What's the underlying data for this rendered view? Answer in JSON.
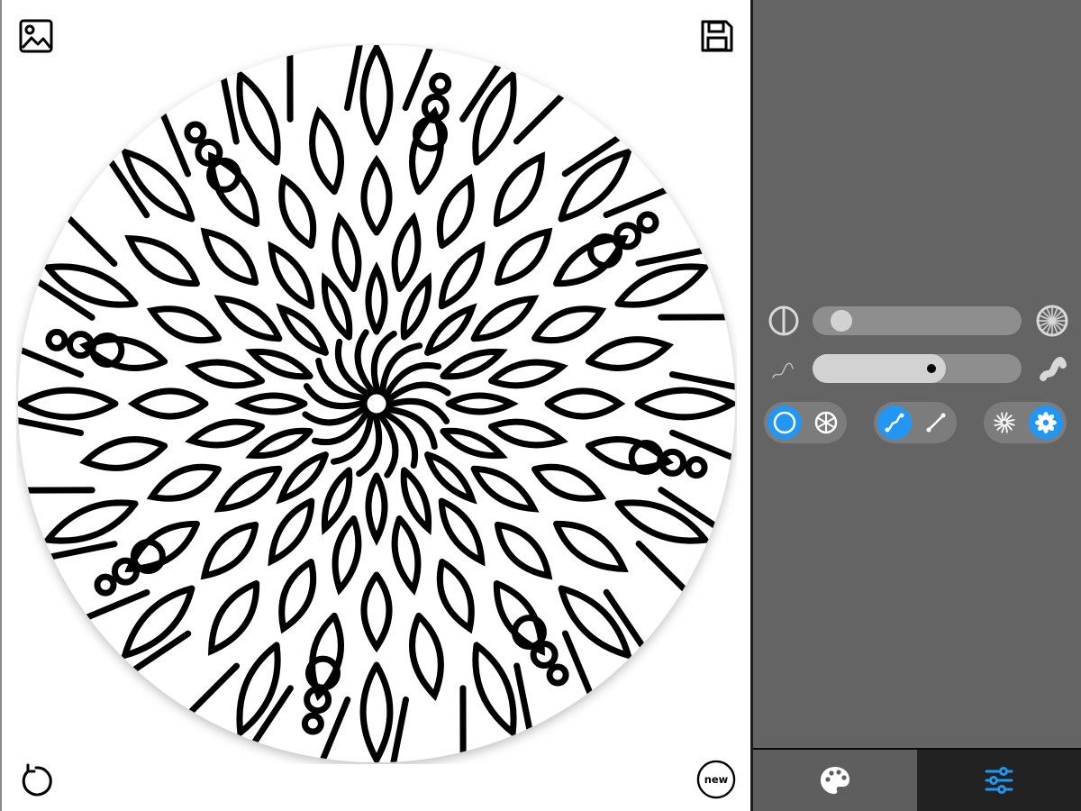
{
  "toolbar": {
    "open_image_icon": "image-icon",
    "save_icon": "floppy-disk-icon",
    "undo_icon": "undo-icon",
    "new_label": "new"
  },
  "settings": {
    "symmetry_slider": {
      "left_icon": "half-circle-icon",
      "right_icon": "radial-circle-icon",
      "value_fraction": 0.08
    },
    "brush_slider": {
      "left_icon": "thin-stroke-icon",
      "right_icon": "thick-stroke-icon",
      "value_fraction": 0.58
    },
    "toggles": [
      {
        "name": "shape",
        "options": [
          "circle-icon",
          "segmented-circle-icon"
        ],
        "selected": 0
      },
      {
        "name": "line-style",
        "options": [
          "curve-icon",
          "straight-line-icon"
        ],
        "selected": 0
      },
      {
        "name": "pattern",
        "options": [
          "starburst-icon",
          "flower-icon"
        ],
        "selected": 1
      }
    ]
  },
  "tabs": [
    {
      "name": "palette",
      "icon": "palette-icon",
      "active": false
    },
    {
      "name": "settings",
      "icon": "sliders-icon",
      "active": true
    }
  ],
  "colors": {
    "accent": "#2196f3",
    "panel": "#646464",
    "bottom_bar": "#1e1e1e"
  }
}
